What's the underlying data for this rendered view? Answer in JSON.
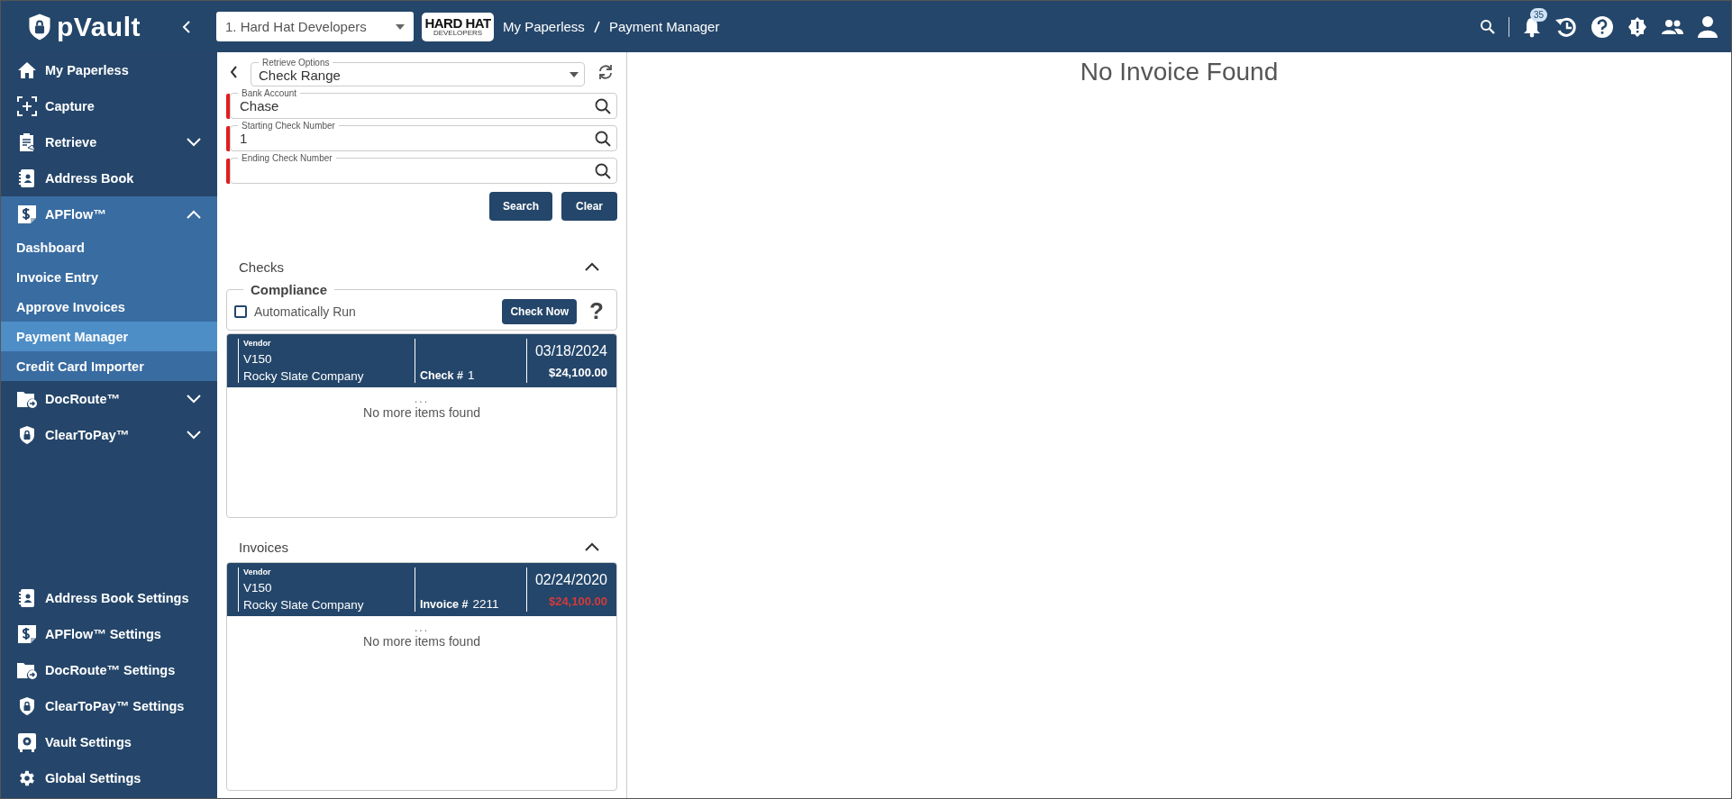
{
  "header": {
    "brand": "pVault",
    "company_select": {
      "value": "1. Hard Hat Developers"
    },
    "company_logo": {
      "title": "HARD HAT",
      "subtitle": "DEVELOPERS"
    },
    "breadcrumb": [
      "My Paperless",
      "Payment Manager"
    ],
    "notifications": {
      "count": "35"
    }
  },
  "sidebar": {
    "items": [
      {
        "label": "My Paperless"
      },
      {
        "label": "Capture"
      },
      {
        "label": "Retrieve",
        "expanded": false
      },
      {
        "label": "Address Book"
      },
      {
        "label": "APFlow™",
        "expanded": true,
        "children": [
          {
            "label": "Dashboard",
            "selected": false
          },
          {
            "label": "Invoice Entry",
            "selected": false
          },
          {
            "label": "Approve Invoices",
            "selected": false
          },
          {
            "label": "Payment Manager",
            "selected": true
          },
          {
            "label": "Credit Card Importer",
            "selected": false
          }
        ]
      },
      {
        "label": "DocRoute™",
        "expanded": false
      },
      {
        "label": "ClearToPay™",
        "expanded": false
      }
    ],
    "settings": [
      {
        "label": "Address Book Settings"
      },
      {
        "label": "APFlow™ Settings"
      },
      {
        "label": "DocRoute™ Settings"
      },
      {
        "label": "ClearToPay™ Settings"
      },
      {
        "label": "Vault Settings"
      },
      {
        "label": "Global Settings"
      }
    ]
  },
  "search_panel": {
    "retrieve_options": {
      "label": "Retrieve Options",
      "value": "Check Range"
    },
    "fields": [
      {
        "label": "Bank Account",
        "value": "Chase",
        "required": true
      },
      {
        "label": "Starting Check Number",
        "value": "1",
        "required": true
      },
      {
        "label": "Ending Check Number",
        "required": true
      }
    ],
    "buttons": [
      "Search",
      "Clear"
    ]
  },
  "checks": {
    "title": "Checks",
    "expanded": true,
    "compliance": {
      "title": "Compliance",
      "auto_run": {
        "label": "Automatically Run",
        "checked": false
      },
      "button": "Check Now",
      "help": "?"
    },
    "rows": [
      {
        "vendor_label": "Vendor",
        "vendor_code": "V150",
        "vendor_name": "Rocky Slate Company",
        "number_label": "Check #",
        "number": "1",
        "date": "03/18/2024",
        "amount": "$24,100.00",
        "amount_flagged": false
      }
    ],
    "ellipsis": "...",
    "empty_text": "No more items found"
  },
  "invoices": {
    "title": "Invoices",
    "expanded": true,
    "rows": [
      {
        "vendor_label": "Vendor",
        "vendor_code": "V150",
        "vendor_name": "Rocky Slate Company",
        "number_label": "Invoice #",
        "number": "2211",
        "date": "02/24/2020",
        "amount": "$24,100.00",
        "amount_flagged": true
      }
    ],
    "ellipsis": "...",
    "empty_text": "No more items found"
  },
  "main": {
    "message": "No Invoice Found"
  }
}
